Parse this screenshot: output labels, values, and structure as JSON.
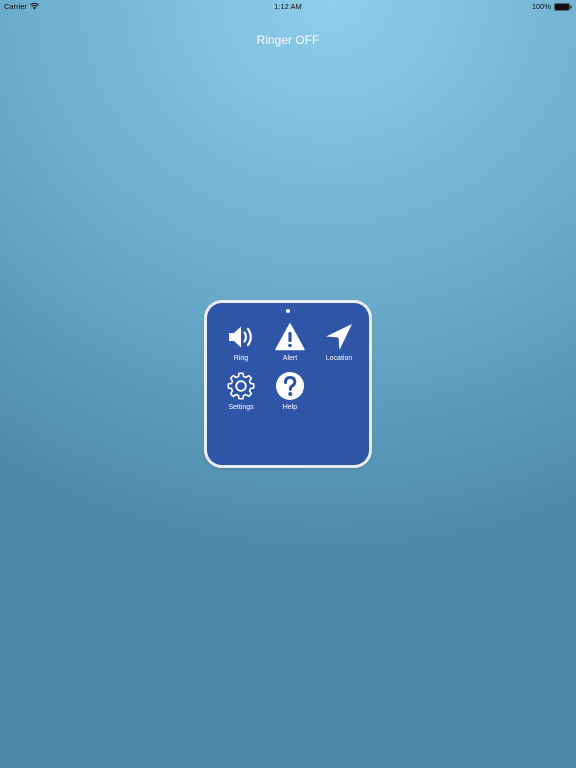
{
  "status_bar": {
    "carrier": "Carrier",
    "time": "1:12 AM",
    "battery": "100%",
    "icons": [
      "wifi-icon",
      "battery-icon"
    ]
  },
  "header": {
    "ringer_status": "Ringer OFF"
  },
  "menu": {
    "items": [
      {
        "label": "Ring",
        "icon": "speaker-icon"
      },
      {
        "label": "Alert",
        "icon": "warning-icon"
      },
      {
        "label": "Location",
        "icon": "location-arrow-icon"
      },
      {
        "label": "Settings",
        "icon": "gear-icon"
      },
      {
        "label": "Help",
        "icon": "question-icon"
      }
    ]
  },
  "colors": {
    "panel_background": "#2e55a8",
    "panel_border": "#e9eef5",
    "background_top": "#8fcdec",
    "background_bottom": "#4f88a8",
    "text": "#ffffff"
  }
}
